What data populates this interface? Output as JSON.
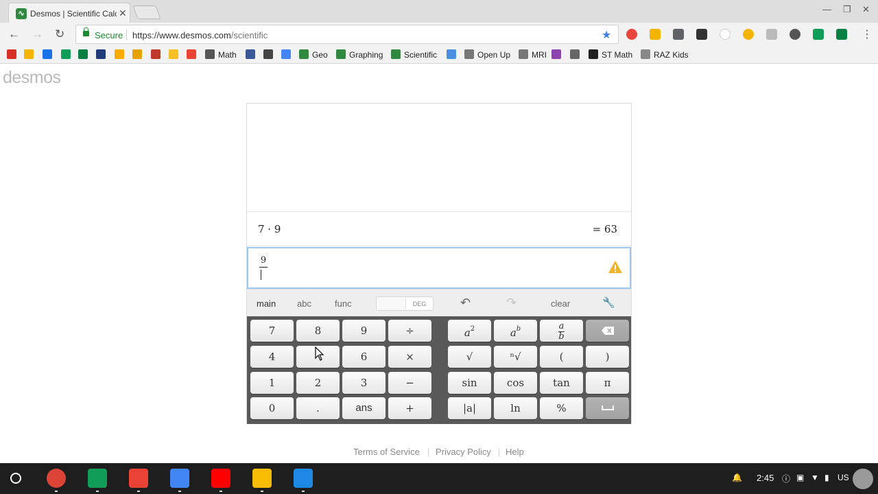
{
  "browser": {
    "tab_title": "Desmos | Scientific Calculator",
    "url_host": "https://www.desmos.com",
    "url_path": "/scientific",
    "secure_label": "Secure"
  },
  "bookmarks": [
    {
      "label": "",
      "color": "#d93025"
    },
    {
      "label": "",
      "color": "#f4b400"
    },
    {
      "label": "",
      "color": "#1a73e8"
    },
    {
      "label": "",
      "color": "#0f9d58"
    },
    {
      "label": "",
      "color": "#0b8043"
    },
    {
      "label": "",
      "color": "#1f3b7a"
    },
    {
      "label": "",
      "color": "#f9ab00"
    },
    {
      "label": "",
      "color": "#e8a200"
    },
    {
      "label": "",
      "color": "#c0392b"
    },
    {
      "label": "",
      "color": "#f6bf26"
    },
    {
      "label": "",
      "color": "#ea4335"
    },
    {
      "label": "Math",
      "color": "#555555"
    },
    {
      "label": "",
      "color": "#3b5998"
    },
    {
      "label": "",
      "color": "#444444"
    },
    {
      "label": "",
      "color": "#4285f4"
    },
    {
      "label": "Geo",
      "color": "#2f8a3f"
    },
    {
      "label": "Graphing",
      "color": "#2f8a3f"
    },
    {
      "label": "Scientific",
      "color": "#2f8a3f"
    },
    {
      "label": "",
      "color": "#4a90e2"
    },
    {
      "label": "Open Up",
      "color": "#777777"
    },
    {
      "label": "MRI",
      "color": "#777777"
    },
    {
      "label": "",
      "color": "#8e44ad"
    },
    {
      "label": "",
      "color": "#666666"
    },
    {
      "label": "ST Math",
      "color": "#222222"
    },
    {
      "label": "RAZ Kids",
      "color": "#888888"
    }
  ],
  "page": {
    "logo": "desmos",
    "history": [
      {
        "expression": "7 · 9",
        "result": "= 63"
      }
    ],
    "input": {
      "numerator": "9"
    },
    "keypad_tabs": [
      {
        "label": "main",
        "active": true
      },
      {
        "label": "abc",
        "active": false
      },
      {
        "label": "func",
        "active": false
      }
    ],
    "angle_mode": "DEG",
    "clear_label": "clear",
    "keys": {
      "k7": "7",
      "k8": "8",
      "k9": "9",
      "div": "÷",
      "k4": "4",
      "k5": "",
      "k6": "6",
      "mul": "×",
      "k1": "1",
      "k2": "2",
      "k3": "3",
      "sub": "−",
      "k0": "0",
      "dot": ".",
      "ans": "ans",
      "add": "+",
      "sqrt": "√",
      "nroot": "ⁿ√",
      "lparen": "(",
      "rparen": ")",
      "sin": "sin",
      "cos": "cos",
      "tan": "tan",
      "pi": "π",
      "abs": "|a|",
      "ln": "ln",
      "pct": "%",
      "pow_base": "a",
      "pow_exp": "2",
      "powb_base": "a",
      "powb_exp": "b",
      "frac_num": "a",
      "frac_den": "b"
    },
    "footer": [
      "Terms of Service",
      "Privacy Policy",
      "Help"
    ]
  },
  "shelf": {
    "time": "2:45",
    "locale": "US",
    "apps": [
      {
        "name": "chrome",
        "color": "#db4437"
      },
      {
        "name": "drive",
        "color": "#0f9d58"
      },
      {
        "name": "gmail",
        "color": "#ea4335"
      },
      {
        "name": "docs",
        "color": "#4285f4"
      },
      {
        "name": "youtube",
        "color": "#ff0000"
      },
      {
        "name": "keep",
        "color": "#fbbc04"
      },
      {
        "name": "geometry-app",
        "color": "#1e88e5"
      }
    ]
  }
}
